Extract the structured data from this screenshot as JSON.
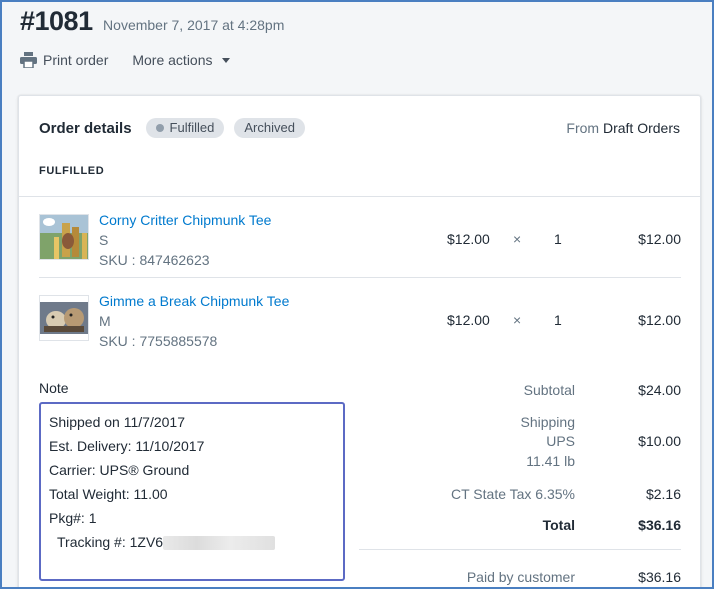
{
  "header": {
    "order_number": "#1081",
    "date": "November 7, 2017 at 4:28pm"
  },
  "actions": {
    "print_label": "Print order",
    "more_label": "More actions"
  },
  "card": {
    "title": "Order details",
    "badges": [
      "Fulfilled",
      "Archived"
    ],
    "from_prefix": "From",
    "from_source": "Draft Orders",
    "section_label": "FULFILLED"
  },
  "items": [
    {
      "name": "Corny Critter Chipmunk Tee",
      "variant": "S",
      "sku": "SKU : 847462623",
      "price": "$12.00",
      "times": "×",
      "qty": "1",
      "total": "$12.00"
    },
    {
      "name": "Gimme a Break Chipmunk Tee",
      "variant": "M",
      "sku": "SKU : 7755885578",
      "price": "$12.00",
      "times": "×",
      "qty": "1",
      "total": "$12.00"
    }
  ],
  "note": {
    "label": "Note",
    "lines": [
      "Shipped on 11/7/2017",
      "Est. Delivery: 11/10/2017",
      "Carrier: UPS® Ground",
      "Total Weight: 11.00",
      "Pkg#: 1",
      "Tracking #: 1ZV6"
    ]
  },
  "summary": {
    "subtotal_label": "Subtotal",
    "subtotal_value": "$24.00",
    "shipping_label": "Shipping",
    "shipping_carrier": "UPS",
    "shipping_weight": "11.41 lb",
    "shipping_value": "$10.00",
    "tax_label": "CT State Tax 6.35%",
    "tax_value": "$2.16",
    "total_label": "Total",
    "total_value": "$36.16",
    "paid_label": "Paid by customer",
    "paid_value": "$36.16"
  },
  "colors": {
    "link": "#007ace",
    "note_border": "#5c6ac4",
    "badge_bg": "#dfe3e8",
    "frame": "#4a7fc1"
  }
}
